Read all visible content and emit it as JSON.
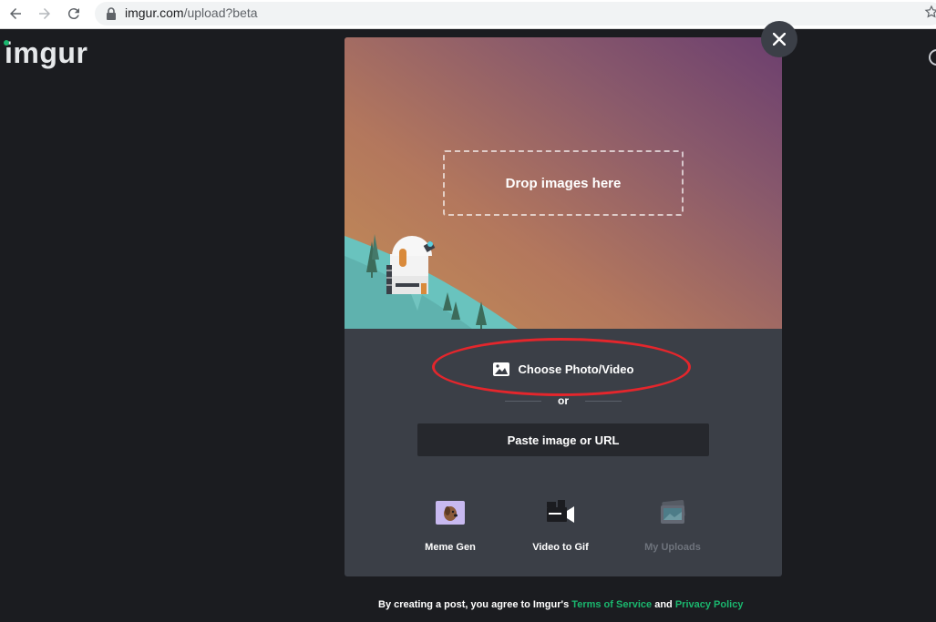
{
  "browser": {
    "url_host": "imgur.com",
    "url_path": "/upload?beta"
  },
  "site": {
    "logo": "imgur",
    "brand_color": "#1bb76e"
  },
  "upload_modal": {
    "drop_text": "Drop images here",
    "choose_label": "Choose Photo/Video",
    "or_label": "or",
    "paste_label": "Paste image or URL",
    "tools": [
      {
        "label": "Meme Gen",
        "icon": "meme-gen-icon",
        "enabled": true
      },
      {
        "label": "Video to Gif",
        "icon": "video-camera-icon",
        "enabled": true
      },
      {
        "label": "My Uploads",
        "icon": "photo-stack-icon",
        "enabled": false
      }
    ],
    "highlight_color": "#e4262c"
  },
  "footer": {
    "prefix": "By creating a post, you agree to Imgur's",
    "terms": "Terms of Service",
    "and": "and",
    "privacy": "Privacy Policy"
  }
}
